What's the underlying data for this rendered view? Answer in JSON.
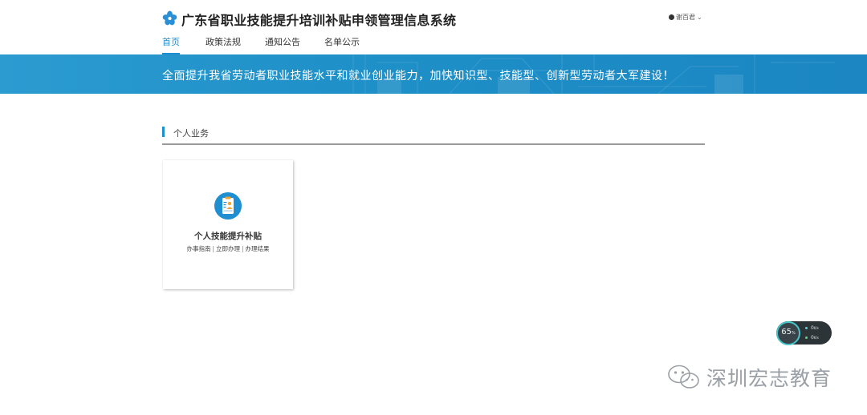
{
  "header": {
    "title": "广东省职业技能提升培训补贴申领管理信息系统",
    "user_name": "谢百君",
    "logo_icon": "flower-logo-icon",
    "dropdown_icon": "chevron-down-icon"
  },
  "nav": {
    "items": [
      {
        "label": "首页",
        "active": true
      },
      {
        "label": "政策法规",
        "active": false
      },
      {
        "label": "通知公告",
        "active": false
      },
      {
        "label": "名单公示",
        "active": false
      }
    ]
  },
  "banner": {
    "slogan": "全面提升我省劳动者职业技能水平和就业创业能力，加快知识型、技能型、创新型劳动者大军建设！"
  },
  "section": {
    "title": "个人业务"
  },
  "cards": [
    {
      "icon": "clipboard-person-icon",
      "title": "个人技能提升补贴",
      "links": [
        "办事指南",
        "立即办理",
        "办理结果"
      ]
    }
  ],
  "speed_widget": {
    "percent": "65",
    "percent_unit": "%",
    "upload": "0",
    "upload_unit": "K/s",
    "download": "0",
    "download_unit": "K/s"
  },
  "watermark": {
    "text": "深圳宏志教育",
    "icon": "wechat-icon"
  },
  "colors": {
    "accent": "#1d8ed0",
    "banner": "#1e8fc7"
  }
}
